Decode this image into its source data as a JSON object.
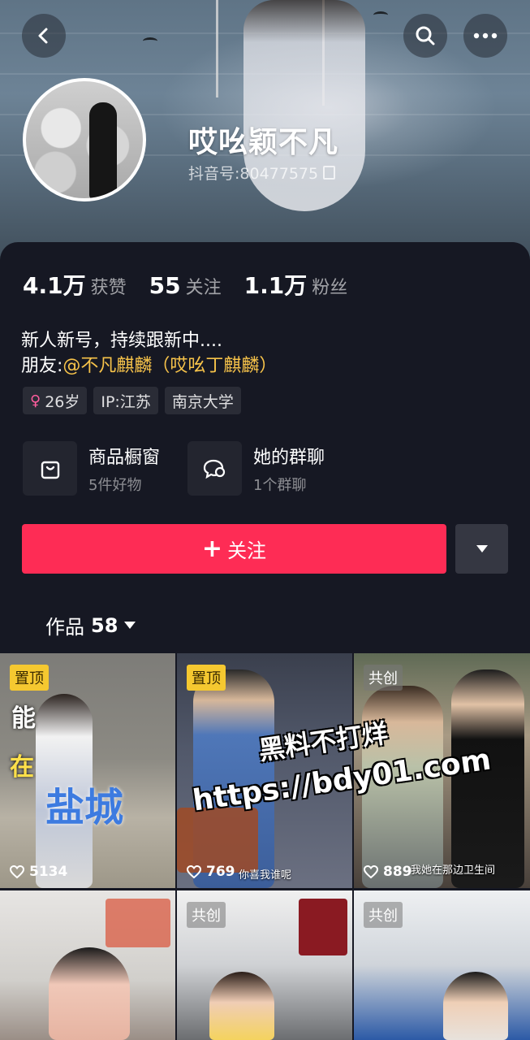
{
  "header": {
    "back_icon": "chevron-left-icon",
    "search_icon": "search-icon",
    "more_icon": "more-dots-icon"
  },
  "profile": {
    "username": "哎吆颖不凡",
    "douyin_id": "抖音号:80477575"
  },
  "stats": [
    {
      "value": "4.1万",
      "label": "获赞"
    },
    {
      "value": "55",
      "label": "关注"
    },
    {
      "value": "1.1万",
      "label": "粉丝"
    }
  ],
  "bio": {
    "line1": "新人新号，持续跟新中....",
    "friend_prefix": "朋友:",
    "friend_mention": "@不凡麒麟（哎吆丁麒麟）"
  },
  "tags": {
    "age": "26岁",
    "ip": "IP:江苏",
    "school": "南京大学"
  },
  "features": [
    {
      "title": "商品橱窗",
      "subtitle": "5件好物",
      "icon": "shopping-bag-icon"
    },
    {
      "title": "她的群聊",
      "subtitle": "1个群聊",
      "icon": "group-chat-icon"
    }
  ],
  "actions": {
    "follow_label": "关注",
    "follow_plus": "+"
  },
  "works": {
    "label": "作品",
    "count": "58"
  },
  "videos": [
    {
      "badge": "置顶",
      "likes": "5134",
      "overlay": [
        "能",
        "在",
        "盐城"
      ]
    },
    {
      "badge": "置顶",
      "likes": "769",
      "caption": "你喜我谁呢"
    },
    {
      "badge": "共创",
      "likes": "889",
      "caption": "我她在那边卫生间"
    },
    {
      "badge": "",
      "likes": ""
    },
    {
      "badge": "共创",
      "likes": ""
    },
    {
      "badge": "共创",
      "likes": ""
    }
  ],
  "watermark": {
    "line1": "黑料不打烊",
    "line2": "https://bdy01.com"
  },
  "colors": {
    "background": "#161823",
    "follow": "#fe2c55",
    "pinned_badge": "#f5c830",
    "mention": "#f7c34a"
  }
}
